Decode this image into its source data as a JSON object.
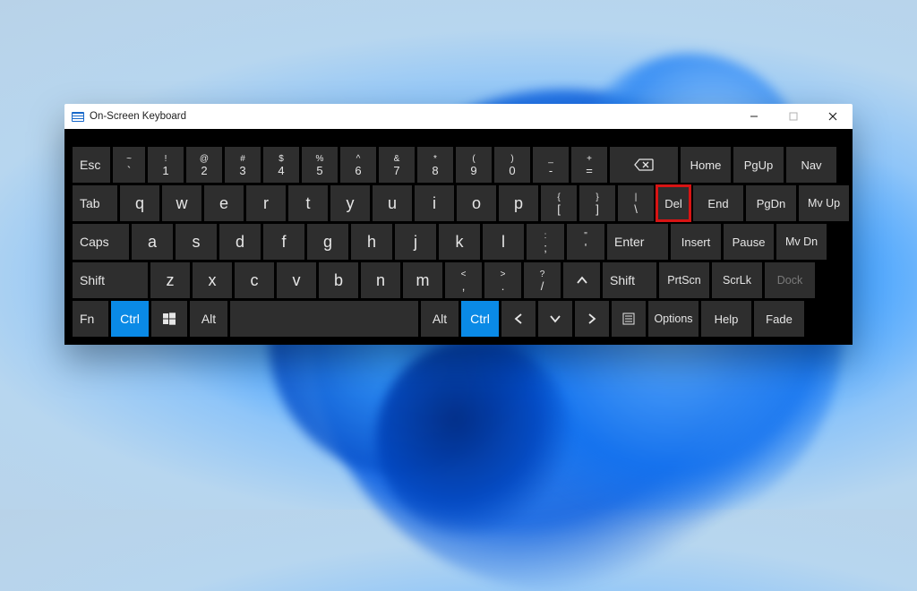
{
  "window": {
    "title": "On-Screen Keyboard"
  },
  "rows": {
    "r1": {
      "esc": "Esc",
      "tilde_top": "~",
      "tilde_bot": "`",
      "n1_top": "!",
      "n1_bot": "1",
      "n2_top": "@",
      "n2_bot": "2",
      "n3_top": "#",
      "n3_bot": "3",
      "n4_top": "$",
      "n4_bot": "4",
      "n5_top": "%",
      "n5_bot": "5",
      "n6_top": "^",
      "n6_bot": "6",
      "n7_top": "&",
      "n7_bot": "7",
      "n8_top": "*",
      "n8_bot": "8",
      "n9_top": "(",
      "n9_bot": "9",
      "n0_top": ")",
      "n0_bot": "0",
      "minus_top": "_",
      "minus_bot": "-",
      "eq_top": "+",
      "eq_bot": "=",
      "home": "Home",
      "pgup": "PgUp",
      "nav": "Nav"
    },
    "r2": {
      "tab": "Tab",
      "q": "q",
      "w": "w",
      "e": "e",
      "r": "r",
      "t": "t",
      "y": "y",
      "u": "u",
      "i": "i",
      "o": "o",
      "p": "p",
      "lb_top": "{",
      "lb_bot": "[",
      "rb_top": "}",
      "rb_bot": "]",
      "bs_top": "|",
      "bs_bot": "\\",
      "del": "Del",
      "end": "End",
      "pgdn": "PgDn",
      "mvup": "Mv Up"
    },
    "r3": {
      "caps": "Caps",
      "a": "a",
      "s": "s",
      "d": "d",
      "f": "f",
      "g": "g",
      "h": "h",
      "j": "j",
      "k": "k",
      "l": "l",
      "semi_top": ":",
      "semi_bot": ";",
      "apos_top": "\"",
      "apos_bot": "'",
      "enter": "Enter",
      "insert": "Insert",
      "pause": "Pause",
      "mvdn": "Mv Dn"
    },
    "r4": {
      "lshift": "Shift",
      "z": "z",
      "x": "x",
      "c": "c",
      "v": "v",
      "b": "b",
      "n": "n",
      "m": "m",
      "comma_top": "<",
      "comma_bot": ",",
      "dot_top": ">",
      "dot_bot": ".",
      "slash_top": "?",
      "slash_bot": "/",
      "rshift": "Shift",
      "prtscn": "PrtScn",
      "scrlk": "ScrLk",
      "dock": "Dock"
    },
    "r5": {
      "fn": "Fn",
      "lctrl": "Ctrl",
      "lalt": "Alt",
      "ralt": "Alt",
      "rctrl": "Ctrl",
      "options": "Options",
      "help": "Help",
      "fade": "Fade"
    }
  }
}
